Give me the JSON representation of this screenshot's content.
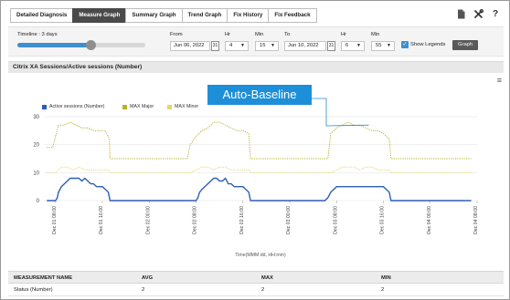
{
  "tabs": [
    "Detailed Diagnosis",
    "Measure Graph",
    "Summary Graph",
    "Trend Graph",
    "Fix History",
    "Fix Feedback"
  ],
  "active_tab": "Measure Graph",
  "toolbar": {
    "icons": [
      "document-icon",
      "tools-icon",
      "help-icon"
    ],
    "help_glyph": "?"
  },
  "controls": {
    "timeline_label": "Timeline : 3 days",
    "timeline_fraction": 0.57,
    "from_label": "From",
    "from_date": "Jun 06, 2022",
    "hr_label": "Hr",
    "from_hr": "4",
    "min_label": "Min",
    "from_min": "15",
    "to_label": "To",
    "to_date": "Jun 10, 2022",
    "to_hr": "6",
    "to_min": "55",
    "calendar_glyph": "31",
    "show_legends_label": "Show Legends",
    "show_legends_checked": true,
    "graph_button": "Graph"
  },
  "chart_panel": {
    "title": "Citrix XA Sessions/Active sessions (Number)"
  },
  "callout": "Auto-Baseline",
  "chart_data": {
    "type": "line",
    "title": "Citrix XA Sessions/Active sessions (Number)",
    "xlabel": "Time(MMM dd, HH:mm)",
    "ylabel": "",
    "ylim": [
      0,
      30
    ],
    "yticks": [
      0,
      10,
      20,
      30
    ],
    "xticks": [
      "Dec 01 08:00",
      "Dec 01 16:00",
      "Dec 02 00:00",
      "Dec 02 08:00",
      "Dec 02 16:00",
      "Dec 03 00:00",
      "Dec 03 08:00",
      "Dec 03 16:00",
      "Dec 04 00:00",
      "Dec 04 08:00"
    ],
    "legend": "top-left",
    "series": [
      {
        "name": "Active sessions (Number)",
        "color": "#2d5fb2",
        "x": [
          -1.5,
          0,
          0.3,
          0.5,
          1.0,
          1.5,
          2.0,
          2.5,
          3.0,
          3.5,
          4.0,
          4.5,
          5.0,
          5.5,
          6.0,
          6.5,
          7.0,
          7.5,
          8.0,
          8.5,
          9.0,
          9.3,
          24.0,
          24.3,
          24.6,
          25.0,
          25.5,
          26.0,
          26.5,
          27.0,
          27.5,
          28.0,
          28.5,
          29.0,
          29.5,
          30.0,
          30.5,
          31.0,
          31.5,
          32.0,
          32.5,
          33.0,
          33.3,
          46.0,
          46.5,
          47.0,
          47.5,
          48.0,
          49.0,
          50.0,
          51.0,
          52.0,
          53.0,
          54.0,
          54.5,
          55.0,
          55.5,
          56.0,
          56.5,
          57.0,
          57.3,
          71.0
        ],
        "y": [
          0,
          0,
          1,
          3,
          5,
          6,
          7,
          8,
          8,
          8,
          8,
          7,
          8,
          7,
          6,
          6,
          5,
          5,
          5,
          4,
          3,
          0,
          0,
          1,
          3,
          4,
          5,
          6,
          7,
          8,
          8,
          7,
          7,
          8,
          6,
          6,
          5,
          5,
          5,
          5,
          4,
          3,
          0,
          0,
          1,
          3,
          4,
          5,
          5,
          5,
          5,
          5,
          5,
          5,
          5,
          5,
          5,
          5,
          4,
          3,
          0,
          0
        ]
      },
      {
        "name": "MAX Major",
        "color": "#b3b32b",
        "x": [
          -1.5,
          -0.5,
          0,
          0.5,
          1.5,
          2.5,
          3.5,
          4.5,
          5.5,
          6.5,
          7.5,
          8.5,
          9.2,
          9.3,
          22.5,
          23.0,
          24.0,
          25.0,
          26.0,
          27.0,
          28.0,
          29.0,
          30.0,
          31.0,
          32.0,
          33.0,
          33.3,
          46.5,
          47.0,
          48.0,
          49.0,
          50.0,
          51.0,
          52.0,
          53.0,
          54.0,
          55.0,
          56.0,
          57.0,
          57.3,
          71.0
        ],
        "y": [
          19,
          19,
          23,
          27,
          27,
          28,
          27,
          26,
          26,
          25,
          25,
          25,
          22,
          15,
          15,
          20,
          23,
          25,
          26,
          28,
          28,
          27,
          26,
          25,
          25,
          24,
          15,
          15,
          24,
          26,
          27,
          28,
          27,
          27,
          26,
          25,
          25,
          24,
          22,
          15,
          15
        ]
      },
      {
        "name": "MAX Minor",
        "color": "#e6d56a",
        "x": [
          -1.5,
          0,
          1,
          2,
          3,
          4,
          5,
          6,
          7,
          8,
          9,
          9.3,
          23,
          24,
          25,
          26,
          27,
          28,
          29,
          30,
          31,
          32,
          33,
          33.3,
          47,
          48,
          49,
          50,
          51,
          52,
          53,
          54,
          55,
          56,
          57,
          57.3,
          71
        ],
        "y": [
          10,
          10,
          12,
          12,
          11,
          12,
          11,
          11,
          11,
          11,
          11,
          10,
          10,
          11,
          12,
          12,
          11,
          12,
          12,
          11,
          11,
          11,
          11,
          10,
          10,
          11,
          12,
          12,
          12,
          11,
          12,
          12,
          11,
          11,
          11,
          10,
          10
        ]
      }
    ]
  },
  "table": {
    "headers": [
      "MEASUREMENT NAME",
      "AVG",
      "MAX",
      "MIN"
    ],
    "rows": [
      [
        "Status (Number)",
        "2",
        "2",
        "2"
      ]
    ]
  }
}
